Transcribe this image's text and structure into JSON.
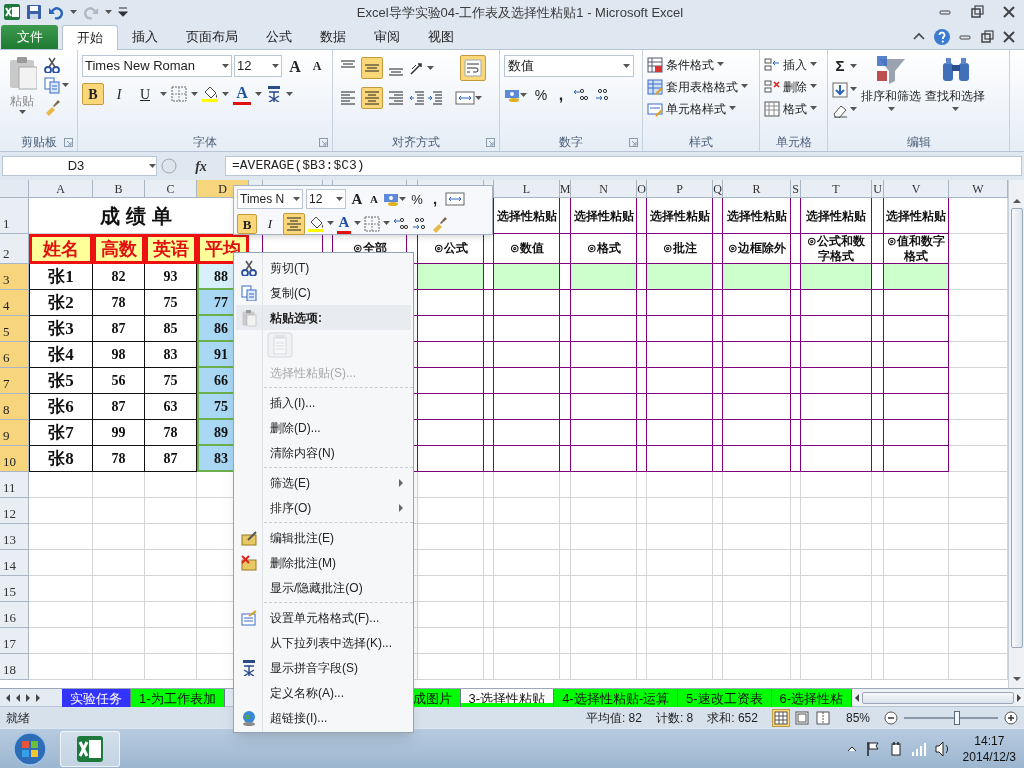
{
  "window": {
    "title": "Excel导学实验04-工作表及选择性粘贴1  -  Microsoft Excel"
  },
  "tabs": [
    {
      "label": "文件",
      "kind": "file",
      "selected": false
    },
    {
      "label": "开始",
      "kind": "tab",
      "selected": true
    },
    {
      "label": "插入",
      "kind": "tab",
      "selected": false
    },
    {
      "label": "页面布局",
      "kind": "tab",
      "selected": false
    },
    {
      "label": "公式",
      "kind": "tab",
      "selected": false
    },
    {
      "label": "数据",
      "kind": "tab",
      "selected": false
    },
    {
      "label": "审阅",
      "kind": "tab",
      "selected": false
    },
    {
      "label": "视图",
      "kind": "tab",
      "selected": false
    }
  ],
  "ribbon": {
    "clipboard": {
      "paste": "粘贴",
      "label": "剪贴板"
    },
    "font": {
      "font_name": "Times New Roman",
      "font_size": "12",
      "grow": "A",
      "shrink": "A",
      "font_color": "A",
      "buttons": [
        {
          "label": "B",
          "selected": true
        },
        {
          "label": "I",
          "selected": false
        },
        {
          "label": "U",
          "selected": false
        }
      ],
      "label": "字体"
    },
    "alignment": {
      "vertical": [
        {
          "selected": false
        },
        {
          "selected": true
        },
        {
          "selected": false
        }
      ],
      "wrap_text": {
        "selected": true
      },
      "horizontal": [
        {
          "selected": false
        },
        {
          "selected": true
        },
        {
          "selected": false
        }
      ],
      "label": "对齐方式"
    },
    "number": {
      "format": "数值",
      "percent": "%",
      "comma": ",",
      "label": "数字"
    },
    "styles": {
      "items": [
        "条件格式",
        "套用表格格式",
        "单元格样式"
      ],
      "label": "样式"
    },
    "cells": {
      "items": [
        "插入",
        "删除",
        "格式"
      ],
      "label": "单元格"
    },
    "editing": {
      "sum": "Σ",
      "items": [
        "排序和筛选",
        "查找和选择"
      ],
      "label": "编辑"
    }
  },
  "formula_bar": {
    "name_box": "D3",
    "fx": "fx",
    "formula": "=AVERAGE($B3:$C3)"
  },
  "sheet": {
    "column_headers": [
      {
        "label": "A",
        "selected": false
      },
      {
        "label": "B",
        "selected": false
      },
      {
        "label": "C",
        "selected": false
      },
      {
        "label": "D",
        "selected": true
      },
      {
        "label": "L",
        "selected": false
      },
      {
        "label": "M",
        "selected": false
      },
      {
        "label": "N",
        "selected": false
      },
      {
        "label": "O",
        "selected": false
      },
      {
        "label": "P",
        "selected": false
      },
      {
        "label": "Q",
        "selected": false
      },
      {
        "label": "R",
        "selected": false
      },
      {
        "label": "S",
        "selected": false
      },
      {
        "label": "T",
        "selected": false
      },
      {
        "label": "U",
        "selected": false
      },
      {
        "label": "V",
        "selected": false
      },
      {
        "label": "W",
        "selected": false
      }
    ],
    "row_headers": [
      {
        "label": "1",
        "selected": false
      },
      {
        "label": "2",
        "selected": false
      },
      {
        "label": "3",
        "selected": true
      },
      {
        "label": "4",
        "selected": true
      },
      {
        "label": "5",
        "selected": true
      },
      {
        "label": "6",
        "selected": true
      },
      {
        "label": "7",
        "selected": true
      },
      {
        "label": "8",
        "selected": true
      },
      {
        "label": "9",
        "selected": true
      },
      {
        "label": "10",
        "selected": true
      },
      {
        "label": "11",
        "selected": false
      },
      {
        "label": "12",
        "selected": false
      },
      {
        "label": "13",
        "selected": false
      },
      {
        "label": "14",
        "selected": false
      },
      {
        "label": "15",
        "selected": false
      },
      {
        "label": "16",
        "selected": false
      },
      {
        "label": "17",
        "selected": false
      },
      {
        "label": "18",
        "selected": false
      }
    ],
    "score_table": {
      "title": "成绩单",
      "headers": [
        "姓名",
        "高数",
        "英语",
        "平均"
      ],
      "rows": [
        {
          "name": "张1",
          "math": "82",
          "english": "93",
          "average": "88",
          "selected": true
        },
        {
          "name": "张2",
          "math": "78",
          "english": "75",
          "average": "77",
          "selected": true
        },
        {
          "name": "张3",
          "math": "87",
          "english": "85",
          "average": "86",
          "selected": true
        },
        {
          "name": "张4",
          "math": "98",
          "english": "83",
          "average": "91",
          "selected": true
        },
        {
          "name": "张5",
          "math": "56",
          "english": "75",
          "average": "66",
          "selected": true
        },
        {
          "name": "张6",
          "math": "87",
          "english": "63",
          "average": "75",
          "selected": true
        },
        {
          "name": "张7",
          "math": "99",
          "english": "78",
          "average": "89",
          "selected": true
        },
        {
          "name": "张8",
          "math": "78",
          "english": "87",
          "average": "83",
          "selected": true
        }
      ]
    },
    "paste_table": {
      "columns": [
        {
          "option": "⊙全部"
        },
        {
          "option": "⊙公式"
        },
        {
          "heading": "选择性粘贴",
          "option": "⊙数值"
        },
        {
          "heading": "选择性粘贴",
          "option": "⊙格式"
        },
        {
          "heading": "选择性粘贴",
          "option": "⊙批注"
        },
        {
          "heading": "选择性粘贴",
          "option": "⊙边框除外"
        },
        {
          "heading": "选择性粘贴",
          "option": "⊙公式和数字格式"
        },
        {
          "heading": "选择性粘贴",
          "option": "⊙值和数字格式"
        }
      ]
    }
  },
  "mini_toolbar": {
    "font_name": "Times N",
    "font_size": "12",
    "grow": "A",
    "shrink": "A",
    "percent": "%",
    "comma": ",",
    "bold": {
      "label": "B",
      "selected": true
    },
    "italic": {
      "label": "I",
      "selected": false
    },
    "center": {
      "selected": true
    },
    "font_color": "A"
  },
  "context_menu": {
    "groups": [
      [
        {
          "label": "剪切(T)",
          "kind": "command",
          "disabled": false,
          "submenu": false
        },
        {
          "label": "复制(C)",
          "kind": "command",
          "disabled": false,
          "submenu": false
        },
        {
          "label": "粘贴选项:",
          "kind": "header",
          "disabled": false,
          "submenu": false
        },
        {
          "kind": "paste_option",
          "disabled": true
        },
        {
          "label": "选择性粘贴(S)...",
          "kind": "command",
          "disabled": true,
          "submenu": false
        }
      ],
      [
        {
          "label": "插入(I)...",
          "kind": "command",
          "disabled": false,
          "submenu": false
        },
        {
          "label": "删除(D)...",
          "kind": "command",
          "disabled": false,
          "submenu": false
        },
        {
          "label": "清除内容(N)",
          "kind": "command",
          "disabled": false,
          "submenu": false
        }
      ],
      [
        {
          "label": "筛选(E)",
          "kind": "command",
          "disabled": false,
          "submenu": true
        },
        {
          "label": "排序(O)",
          "kind": "command",
          "disabled": false,
          "submenu": true
        }
      ],
      [
        {
          "label": "编辑批注(E)",
          "kind": "command",
          "disabled": false,
          "submenu": false
        },
        {
          "label": "删除批注(M)",
          "kind": "command",
          "disabled": false,
          "submenu": false
        },
        {
          "label": "显示/隐藏批注(O)",
          "kind": "command",
          "disabled": false,
          "submenu": false
        }
      ],
      [
        {
          "label": "设置单元格格式(F)...",
          "kind": "command",
          "disabled": false,
          "submenu": false
        },
        {
          "label": "从下拉列表中选择(K)...",
          "kind": "command",
          "disabled": false,
          "submenu": false
        },
        {
          "label": "显示拼音字段(S)",
          "kind": "command",
          "disabled": false,
          "submenu": false
        },
        {
          "label": "定义名称(A)...",
          "kind": "command",
          "disabled": false,
          "submenu": false
        },
        {
          "label": "超链接(I)...",
          "kind": "command",
          "disabled": false,
          "submenu": false
        }
      ]
    ]
  },
  "sheet_tabs": [
    {
      "label": "实验任务",
      "color": "#3333ff",
      "selected": false
    },
    {
      "label": "1-为工作表加",
      "color": "#00ff00",
      "selected": false
    },
    {
      "label": "成图片",
      "color": "#00ff00",
      "selected": false
    },
    {
      "label": "3-选择性粘贴",
      "color": "#00ff00",
      "selected": true
    },
    {
      "label": "4-选择性粘贴-运算",
      "color": "#00ff00",
      "selected": false
    },
    {
      "label": "5-速改工资表",
      "color": "#00ff00",
      "selected": false
    },
    {
      "label": "6-选择性粘",
      "color": "#00ff00",
      "selected": false
    }
  ],
  "status_bar": {
    "mode": "就绪",
    "stats": [
      "平均值: 82",
      "计数: 8",
      "求和: 652"
    ],
    "views": [
      {
        "selected": true
      },
      {
        "selected": false
      },
      {
        "selected": false
      }
    ],
    "zoom": "85%",
    "zoom_slider": {
      "level": 0.56
    }
  },
  "taskbar": {
    "apps": [
      {
        "selected": true
      }
    ],
    "time": "14:17",
    "date": "2014/12/3"
  }
}
